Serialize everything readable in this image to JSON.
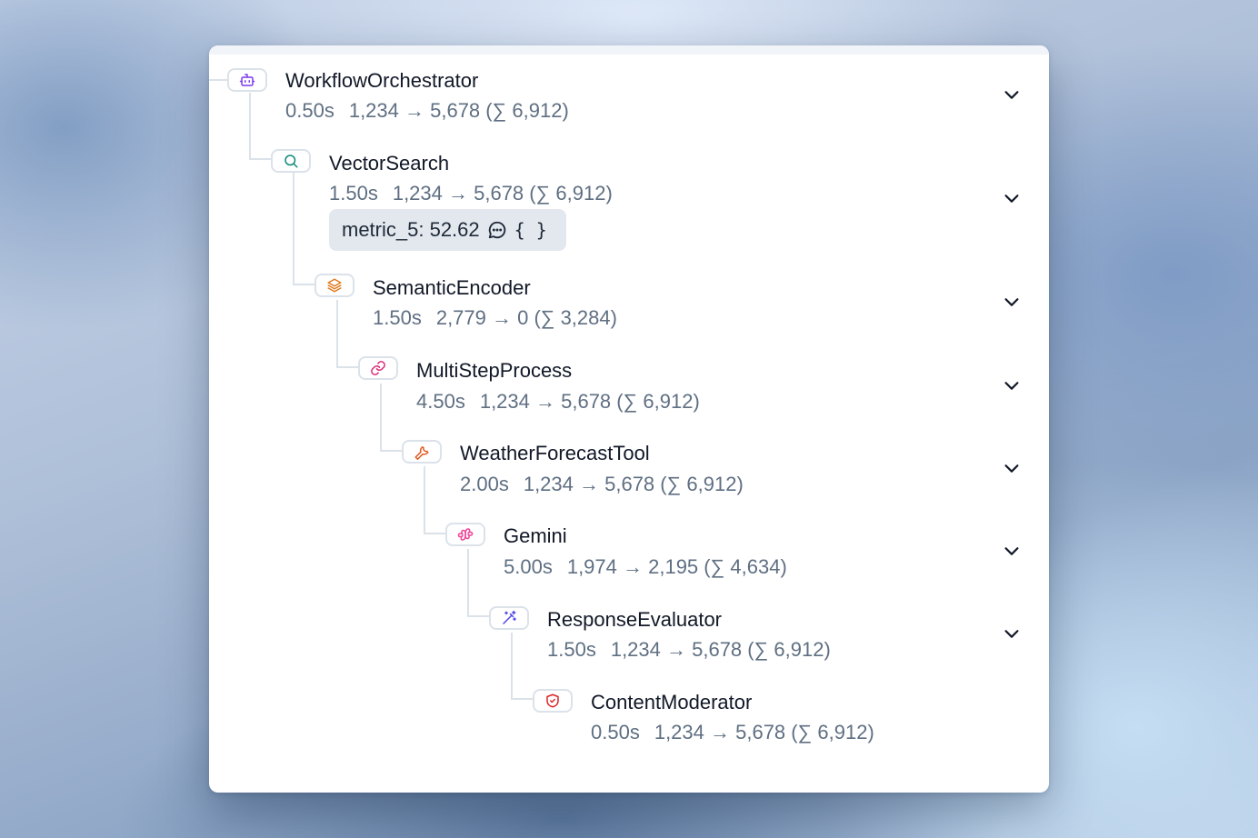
{
  "nodes": [
    {
      "name": "WorkflowOrchestrator",
      "duration": "0.50s",
      "tokens": "1,234 → 5,678 (∑ 6,912)",
      "icon": "robot-icon",
      "icon_color": "#7c3aed",
      "expandable": true
    },
    {
      "name": "VectorSearch",
      "duration": "1.50s",
      "tokens": "1,234 → 5,678 (∑ 6,912)",
      "icon": "search-icon",
      "icon_color": "#0f8a7a",
      "expandable": true,
      "metric": {
        "text": "metric_5: 52.62",
        "icons": [
          "comment-icon",
          "braces-icon"
        ],
        "braces": "{ }"
      }
    },
    {
      "name": "SemanticEncoder",
      "duration": "1.50s",
      "tokens": "2,779 → 0 (∑ 3,284)",
      "icon": "layers-icon",
      "icon_color": "#e07a1f",
      "expandable": true
    },
    {
      "name": "MultiStepProcess",
      "duration": "4.50s",
      "tokens": "1,234 → 5,678 (∑ 6,912)",
      "icon": "link-icon",
      "icon_color": "#db2777",
      "expandable": true
    },
    {
      "name": "WeatherForecastTool",
      "duration": "2.00s",
      "tokens": "1,234 → 5,678 (∑ 6,912)",
      "icon": "wrench-icon",
      "icon_color": "#e05a1f",
      "expandable": true
    },
    {
      "name": "Gemini",
      "duration": "5.00s",
      "tokens": "1,974 → 2,195 (∑ 4,634)",
      "icon": "gemini-icon",
      "icon_color": "#ec4899",
      "expandable": true
    },
    {
      "name": "ResponseEvaluator",
      "duration": "1.50s",
      "tokens": "1,234 → 5,678 (∑ 6,912)",
      "icon": "magic-wand-icon",
      "icon_color": "#4f46e5",
      "expandable": true
    },
    {
      "name": "ContentModerator",
      "duration": "0.50s",
      "tokens": "1,234 → 5,678 (∑ 6,912)",
      "icon": "shield-check-icon",
      "icon_color": "#dc2626",
      "expandable": false
    }
  ]
}
